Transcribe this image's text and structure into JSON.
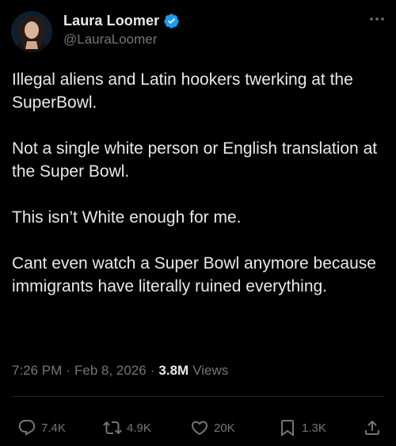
{
  "author": {
    "display_name": "Laura Loomer",
    "handle": "@LauraLoomer",
    "verified": true
  },
  "tweet": {
    "paragraphs": [
      "Illegal aliens and Latin hookers twerking at the SuperBowl.",
      "Not a single white person or English translation at the Super Bowl.",
      "This isn’t White enough for me.",
      "Cant even watch a Super Bowl anymore because immigrants have literally ruined everything."
    ],
    "time": "7:26 PM",
    "separator": "·",
    "date": "Feb 8, 2026",
    "views_count": "3.8M",
    "views_label": "Views"
  },
  "actions": {
    "replies": "7.4K",
    "reposts": "4.9K",
    "likes": "20K",
    "bookmarks": "1.3K"
  },
  "colors": {
    "background": "#000000",
    "text": "#e7e9ea",
    "muted": "#71767b",
    "verified_badge": "#1d9bf0"
  },
  "icons": {
    "more": "more-dots-icon",
    "verified": "verified-badge-icon",
    "reply": "reply-icon",
    "repost": "repost-icon",
    "like": "heart-icon",
    "bookmark": "bookmark-icon",
    "share": "share-icon"
  }
}
